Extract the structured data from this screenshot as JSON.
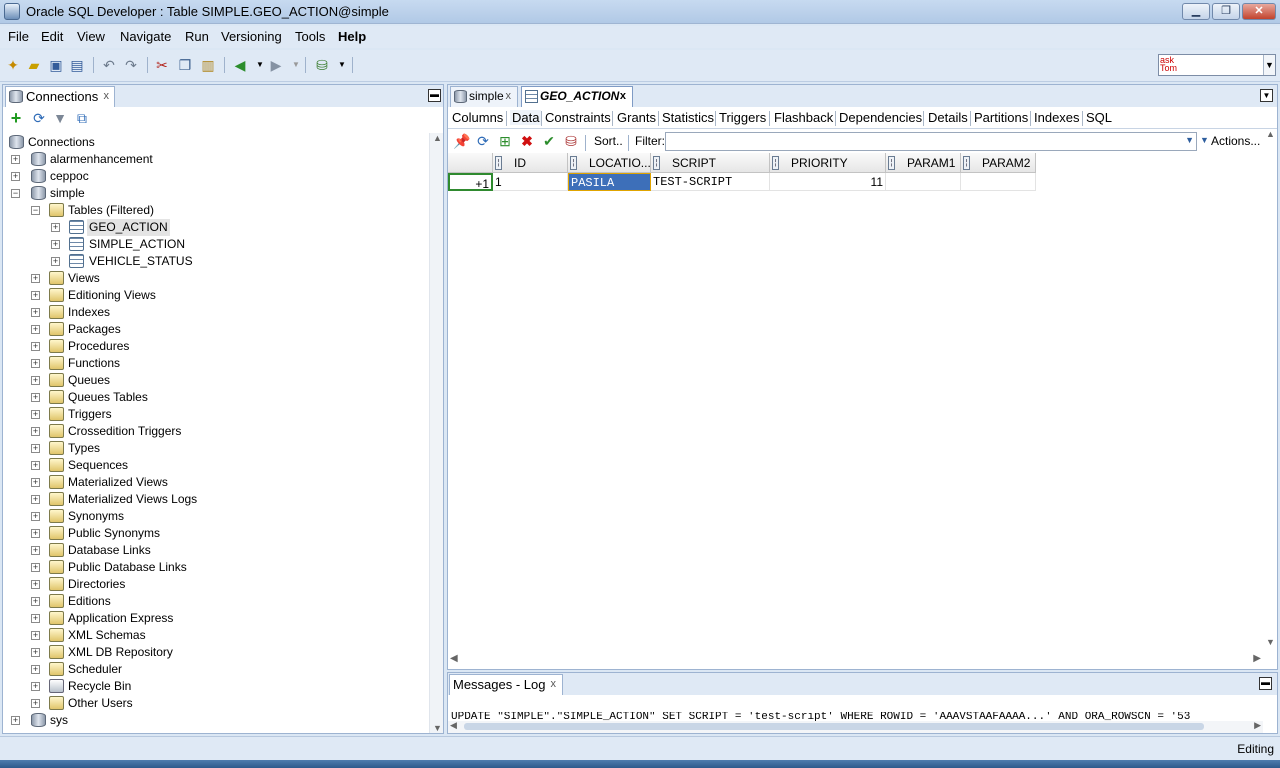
{
  "window": {
    "title": "Oracle SQL Developer : Table SIMPLE.GEO_ACTION@simple"
  },
  "menu": [
    "File",
    "Edit",
    "View",
    "Navigate",
    "Run",
    "Versioning",
    "Tools",
    "Help"
  ],
  "asktom": {
    "label": "ask Tom"
  },
  "connections_panel": {
    "tab_label": "Connections",
    "tab_close": "x",
    "root_label": "Connections",
    "connections": [
      "alarmenhancement",
      "ceppoc",
      "simple",
      "sys"
    ],
    "tables_label": "Tables (Filtered)",
    "tables": [
      "GEO_ACTION",
      "SIMPLE_ACTION",
      "VEHICLE_STATUS"
    ],
    "object_types": [
      "Views",
      "Editioning Views",
      "Indexes",
      "Packages",
      "Procedures",
      "Functions",
      "Queues",
      "Queues Tables",
      "Triggers",
      "Crossedition Triggers",
      "Types",
      "Sequences",
      "Materialized Views",
      "Materialized Views Logs",
      "Synonyms",
      "Public Synonyms",
      "Database Links",
      "Public Database Links",
      "Directories",
      "Editions",
      "Application Express",
      "XML Schemas",
      "XML DB Repository",
      "Scheduler",
      "Recycle Bin",
      "Other Users"
    ]
  },
  "editor": {
    "tabs": [
      {
        "label": "simple",
        "close": "x"
      },
      {
        "label": "GEO_ACTION",
        "close": "x"
      }
    ],
    "subtabs": [
      "Columns",
      "Data",
      "Constraints",
      "Grants",
      "Statistics",
      "Triggers",
      "Flashback",
      "Dependencies",
      "Details",
      "Partitions",
      "Indexes",
      "SQL"
    ],
    "sort_label": "Sort..",
    "filter_label": "Filter:",
    "actions_label": "Actions...",
    "grid": {
      "headers": [
        "ID",
        "LOCATIO...",
        "SCRIPT",
        "PRIORITY",
        "PARAM1",
        "PARAM2"
      ],
      "rows": [
        {
          "marker": "+1",
          "cells": [
            "1",
            "PASILA",
            "TEST-SCRIPT",
            "11",
            "",
            ""
          ]
        }
      ]
    }
  },
  "messages": {
    "tab_label": "Messages - Log",
    "tab_close": "x",
    "log_line": "UPDATE \"SIMPLE\".\"SIMPLE_ACTION\" SET SCRIPT = 'test-script' WHERE ROWID = 'AAAVSTAAFAAAA...' AND ORA_ROWSCN = '53"
  },
  "status": {
    "mode": "Editing"
  }
}
